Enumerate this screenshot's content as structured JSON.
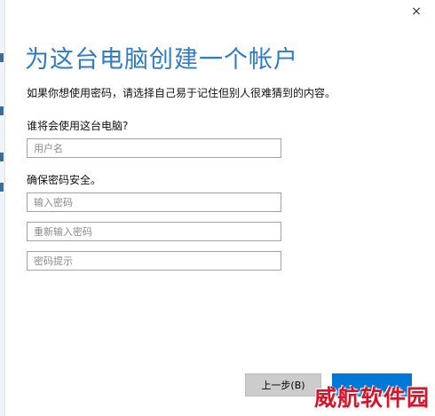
{
  "window": {
    "close_glyph": "×"
  },
  "header": {
    "title": "为这台电脑创建一个帐户"
  },
  "intro": "如果你想使用密码，请选择自己易于记住但别人很难猜到的内容。",
  "user_section": {
    "label": "谁将会使用这台电脑?",
    "username_placeholder": "用户名",
    "username_value": ""
  },
  "password_section": {
    "label": "确保密码安全。",
    "password_placeholder": "输入密码",
    "password_value": "",
    "confirm_placeholder": "重新输入密码",
    "confirm_value": "",
    "hint_placeholder": "密码提示",
    "hint_value": ""
  },
  "footer": {
    "back_label": "上一步(B)",
    "next_label": ""
  },
  "watermark": "威航软件园",
  "colors": {
    "accent": "#0078d7",
    "title": "#2f7ac9",
    "watermark": "#d4162b"
  }
}
